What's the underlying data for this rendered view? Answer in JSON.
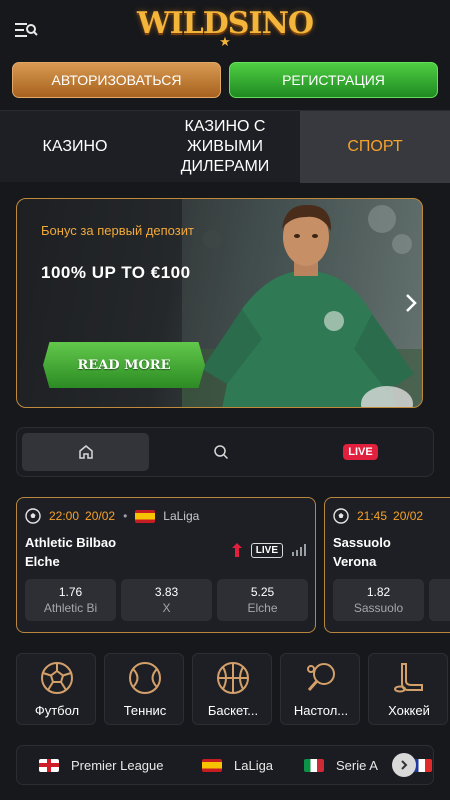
{
  "app": {
    "logo_text": "WILDSINO"
  },
  "auth": {
    "login_label": "АВТОРИЗОВАТЬСЯ",
    "register_label": "РЕГИСТРАЦИЯ"
  },
  "tabs": [
    {
      "label": "КАЗИНО"
    },
    {
      "label": "КАЗИНО С ЖИВЫМИ ДИЛЕРАМИ"
    },
    {
      "label": "СПОРТ",
      "active": true
    }
  ],
  "banner": {
    "subtitle": "Бонус за первый депозит",
    "title": "100% UP TO €100",
    "cta_label": "READ MORE"
  },
  "filter": {
    "live_label": "LIVE"
  },
  "matches": [
    {
      "time": "22:00",
      "date": "20/02",
      "league": "LaLiga",
      "team_a": "Athletic Bilbao",
      "team_b": "Elche",
      "live_label": "LIVE",
      "odds": [
        {
          "value": "1.76",
          "name": "Athletic Bi"
        },
        {
          "value": "3.83",
          "name": "X"
        },
        {
          "value": "5.25",
          "name": "Elche"
        }
      ]
    },
    {
      "time": "21:45",
      "date": "20/02",
      "team_a": "Sassuolo",
      "team_b": "Verona",
      "odds": [
        {
          "value": "1.82",
          "name": "Sassuolo"
        }
      ]
    }
  ],
  "sports": [
    {
      "label": "Футбол",
      "icon": "soccer-ball-icon"
    },
    {
      "label": "Теннис",
      "icon": "tennis-ball-icon"
    },
    {
      "label": "Баскет...",
      "icon": "basketball-icon"
    },
    {
      "label": "Настол...",
      "icon": "table-tennis-icon"
    },
    {
      "label": "Хоккей",
      "icon": "hockey-icon"
    }
  ],
  "leagues": [
    {
      "label": "Premier League",
      "flag": "england"
    },
    {
      "label": "LaLiga",
      "flag": "spain"
    },
    {
      "label": "Serie A",
      "flag": "italy"
    }
  ],
  "colors": {
    "accent": "#f6a228",
    "login": "#c27a31",
    "register": "#36ad32",
    "live": "#e0203c"
  }
}
